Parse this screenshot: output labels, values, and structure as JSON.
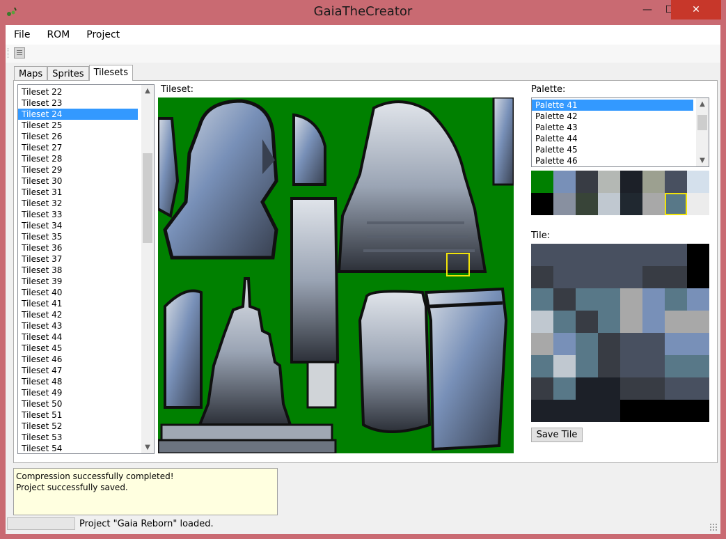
{
  "window": {
    "title": "GaiaTheCreator",
    "minimize_glyph": "—",
    "maximize_glyph": "☐",
    "close_glyph": "✕"
  },
  "menu": {
    "items": [
      "File",
      "ROM",
      "Project"
    ]
  },
  "tabs": [
    {
      "label": "Maps",
      "active": false
    },
    {
      "label": "Sprites",
      "active": false
    },
    {
      "label": "Tilesets",
      "active": true
    }
  ],
  "tileset_list": {
    "items": [
      "Tileset 22",
      "Tileset 23",
      "Tileset 24",
      "Tileset 25",
      "Tileset 26",
      "Tileset 27",
      "Tileset 28",
      "Tileset 29",
      "Tileset 30",
      "Tileset 31",
      "Tileset 32",
      "Tileset 33",
      "Tileset 34",
      "Tileset 35",
      "Tileset 36",
      "Tileset 37",
      "Tileset 38",
      "Tileset 39",
      "Tileset 40",
      "Tileset 41",
      "Tileset 42",
      "Tileset 43",
      "Tileset 44",
      "Tileset 45",
      "Tileset 46",
      "Tileset 47",
      "Tileset 48",
      "Tileset 49",
      "Tileset 50",
      "Tileset 51",
      "Tileset 52",
      "Tileset 53",
      "Tileset 54"
    ],
    "selected": "Tileset 24",
    "scroll_position": 0.22,
    "scroll_visible_fraction": 0.26
  },
  "tileset_panel": {
    "label": "Tileset:"
  },
  "palette_panel": {
    "label": "Palette:",
    "items": [
      "Palette 41",
      "Palette 42",
      "Palette 43",
      "Palette 44",
      "Palette 45",
      "Palette 46"
    ],
    "selected": "Palette 41",
    "colors": [
      "#008000",
      "#7890b8",
      "#383c44",
      "#b4b8b4",
      "#1c2028",
      "#9ca090",
      "#485060",
      "#d4e0ec",
      "#000000",
      "#8890a0",
      "#384438",
      "#c0c8d0",
      "#202830",
      "#a8a8a8",
      "#587888",
      "#ececec"
    ],
    "selected_color_index": 14
  },
  "tile_panel": {
    "label": "Tile:",
    "pixels": [
      [
        6,
        6,
        6,
        6,
        6,
        6,
        6,
        8
      ],
      [
        2,
        6,
        6,
        6,
        6,
        2,
        2,
        8
      ],
      [
        14,
        2,
        14,
        14,
        13,
        1,
        14,
        1
      ],
      [
        11,
        14,
        2,
        14,
        13,
        1,
        13,
        13
      ],
      [
        13,
        1,
        14,
        2,
        6,
        6,
        1,
        1
      ],
      [
        14,
        11,
        14,
        2,
        6,
        6,
        14,
        14
      ],
      [
        2,
        14,
        4,
        4,
        2,
        2,
        6,
        6
      ],
      [
        4,
        4,
        4,
        4,
        8,
        8,
        8,
        8
      ]
    ],
    "save_button": "Save Tile"
  },
  "log": {
    "lines": [
      "Compression successfully completed!",
      "Project successfully saved."
    ]
  },
  "status": {
    "text": "Project \"Gaia Reborn\" loaded."
  }
}
